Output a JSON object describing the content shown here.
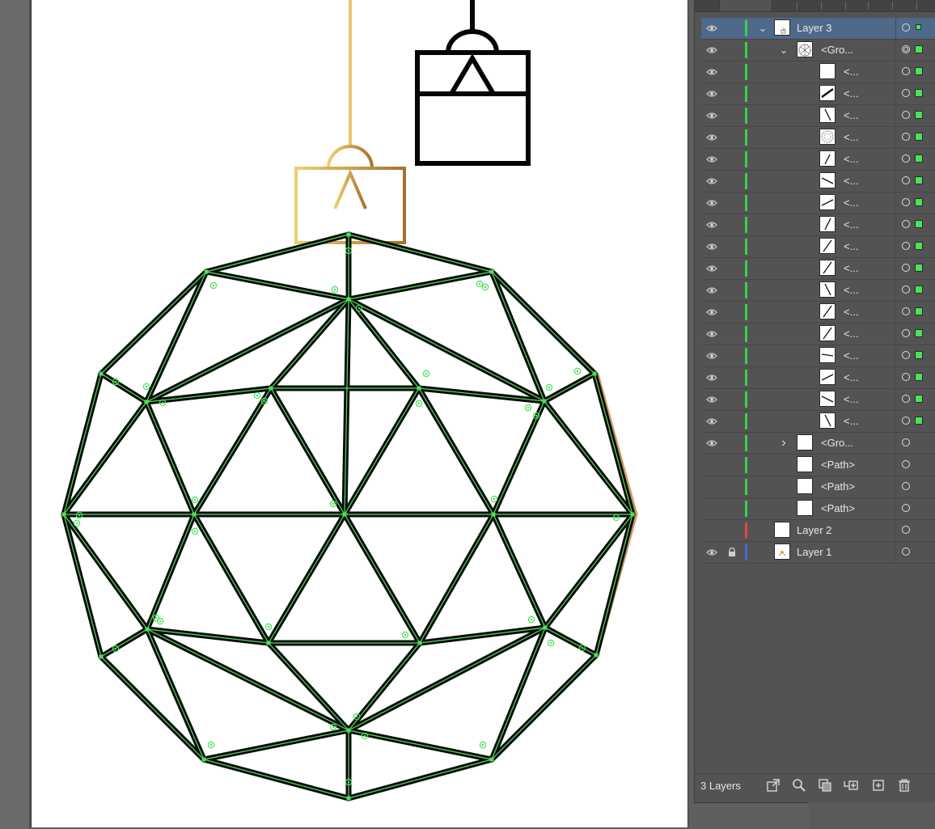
{
  "artboard": {
    "ornament_colors": {
      "gold_light": "#f0cf6d",
      "gold_dark": "#a7722b",
      "mesh_stroke": "#0a0a0a",
      "selection_green": "#4be15a",
      "copper_edge": "#b07a3a"
    }
  },
  "layers_panel": {
    "rows": [
      {
        "name": "Layer 3",
        "icon": "eye-icon",
        "expanded": true,
        "color": "#38d24a",
        "selected": true
      },
      {
        "name": "<Gro...",
        "icon": "eye-icon",
        "expanded": true
      },
      {
        "name": "<...",
        "icon": "eye-icon"
      },
      {
        "name": "<...",
        "icon": "eye-icon"
      },
      {
        "name": "<...",
        "icon": "eye-icon"
      },
      {
        "name": "<...",
        "icon": "eye-icon"
      },
      {
        "name": "<...",
        "icon": "eye-icon"
      },
      {
        "name": "<...",
        "icon": "eye-icon"
      },
      {
        "name": "<...",
        "icon": "eye-icon"
      },
      {
        "name": "<...",
        "icon": "eye-icon"
      },
      {
        "name": "<...",
        "icon": "eye-icon"
      },
      {
        "name": "<...",
        "icon": "eye-icon"
      },
      {
        "name": "<...",
        "icon": "eye-icon"
      },
      {
        "name": "<...",
        "icon": "eye-icon"
      },
      {
        "name": "<...",
        "icon": "eye-icon"
      },
      {
        "name": "<...",
        "icon": "eye-icon"
      },
      {
        "name": "<...",
        "icon": "eye-icon"
      },
      {
        "name": "<...",
        "icon": "eye-icon"
      },
      {
        "name": "<...",
        "icon": "eye-icon"
      },
      {
        "name": "<Gro...",
        "icon": "eye-icon",
        "expanded": false
      },
      {
        "name": "<Path>"
      },
      {
        "name": "<Path>"
      },
      {
        "name": "<Path>"
      },
      {
        "name": "Layer 2",
        "color": "#e0464b"
      },
      {
        "name": "Layer 1",
        "icon": "eye-icon",
        "locked": true,
        "color": "#3f6fd8"
      }
    ]
  },
  "footer": {
    "layer_count": "3 Layers",
    "icons": [
      "export-icon",
      "search-icon",
      "clipping-mask-icon",
      "new-sublayer-icon",
      "new-layer-icon",
      "trash-icon"
    ]
  }
}
